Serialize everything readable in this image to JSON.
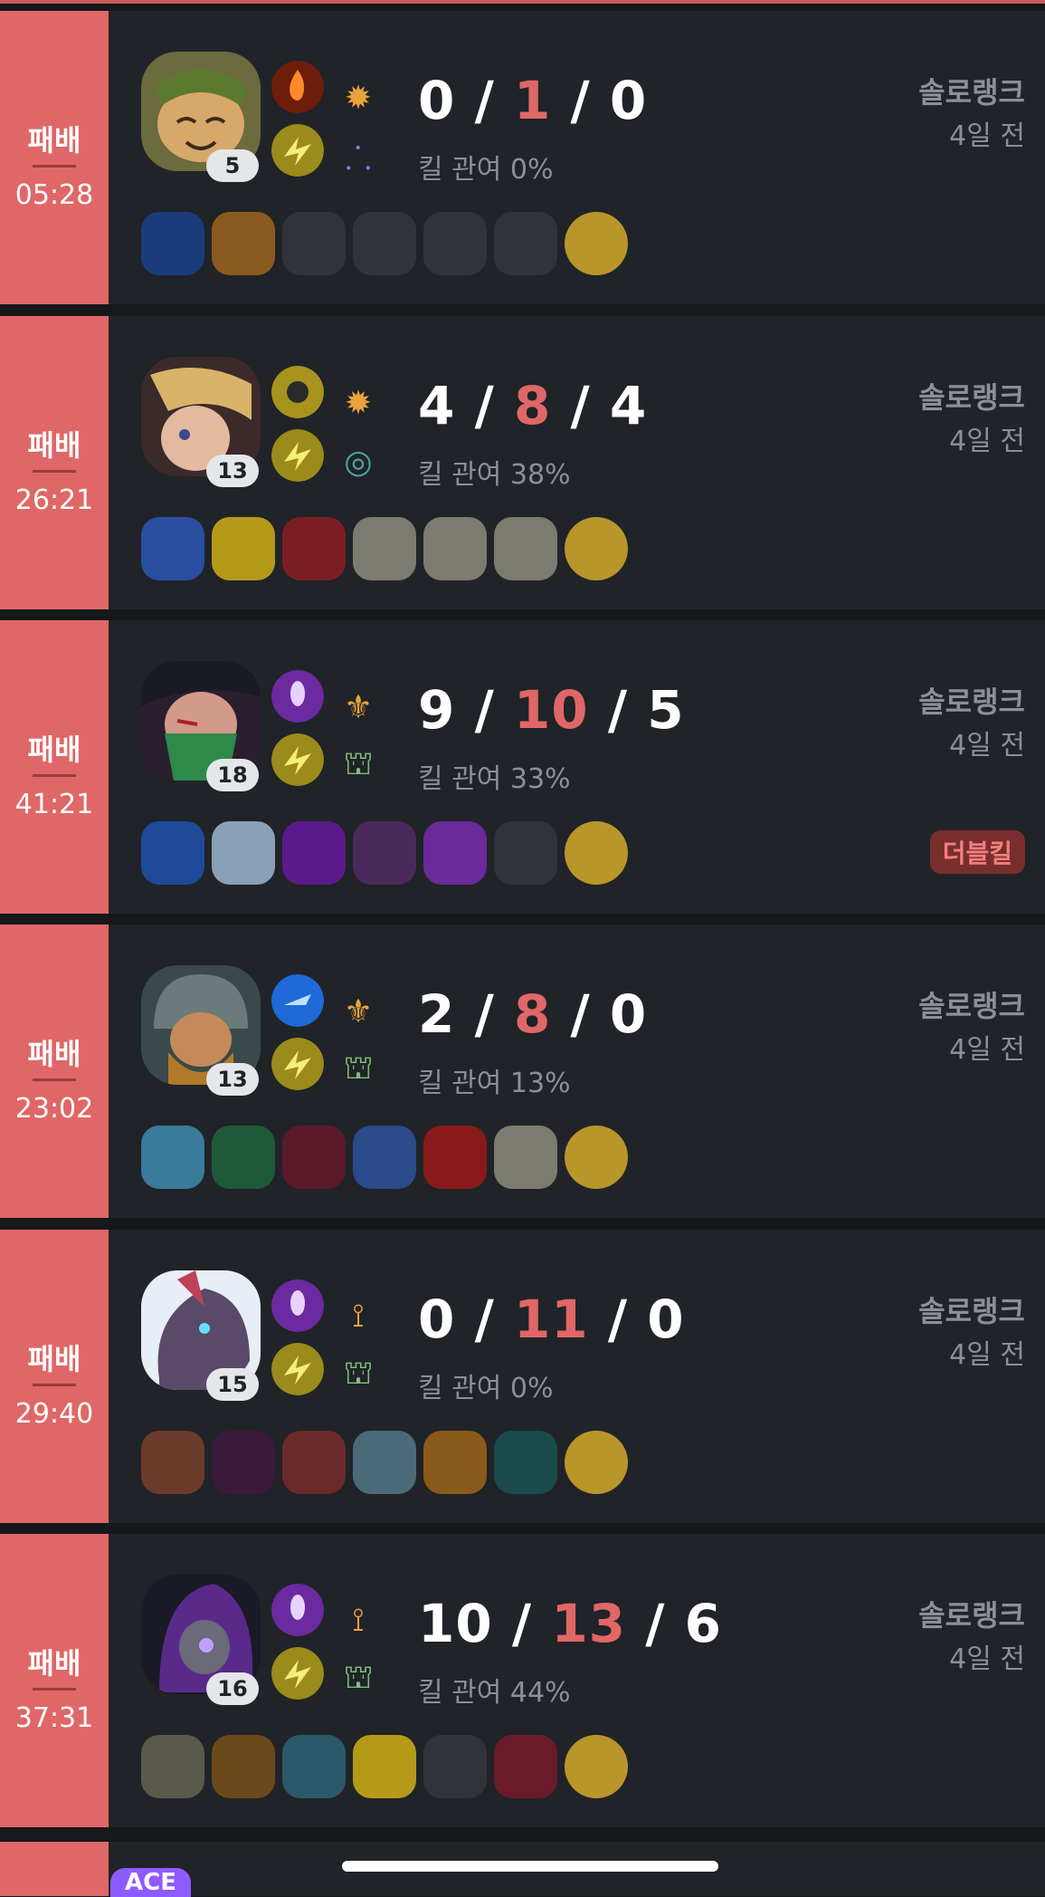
{
  "matches": [
    {
      "result": "패배",
      "duration": "05:28",
      "level": "5",
      "kda": {
        "k": "0",
        "d": "1",
        "a": "0"
      },
      "kill_participation": "킬 관여 0%",
      "queue": "솔로랭크",
      "time_ago": "4일 전",
      "champion_icon": "teemo-portrait-icon",
      "badge": ""
    },
    {
      "result": "패배",
      "duration": "26:21",
      "level": "13",
      "kda": {
        "k": "4",
        "d": "8",
        "a": "4"
      },
      "kill_participation": "킬 관여 38%",
      "queue": "솔로랭크",
      "time_ago": "4일 전",
      "champion_icon": "ezreal-portrait-icon",
      "badge": ""
    },
    {
      "result": "패배",
      "duration": "41:21",
      "level": "18",
      "kda": {
        "k": "9",
        "d": "10",
        "a": "5"
      },
      "kill_participation": "킬 관여 33%",
      "queue": "솔로랭크",
      "time_ago": "4일 전",
      "champion_icon": "akali-portrait-icon",
      "badge": "더블킬"
    },
    {
      "result": "패배",
      "duration": "23:02",
      "level": "13",
      "kda": {
        "k": "2",
        "d": "8",
        "a": "0"
      },
      "kill_participation": "킬 관여 13%",
      "queue": "솔로랭크",
      "time_ago": "4일 전",
      "champion_icon": "olaf-portrait-icon",
      "badge": ""
    },
    {
      "result": "패배",
      "duration": "29:40",
      "level": "15",
      "kda": {
        "k": "0",
        "d": "11",
        "a": "0"
      },
      "kill_participation": "킬 관여 0%",
      "queue": "솔로랭크",
      "time_ago": "4일 전",
      "champion_icon": "twitch-portrait-icon",
      "badge": ""
    },
    {
      "result": "패배",
      "duration": "37:31",
      "level": "16",
      "kda": {
        "k": "10",
        "d": "13",
        "a": "6"
      },
      "kill_participation": "킬 관여 44%",
      "queue": "솔로랭크",
      "time_ago": "4일 전",
      "champion_icon": "kassadin-portrait-icon",
      "badge": ""
    }
  ],
  "next_badge": "ACE",
  "kda_separator": "/"
}
